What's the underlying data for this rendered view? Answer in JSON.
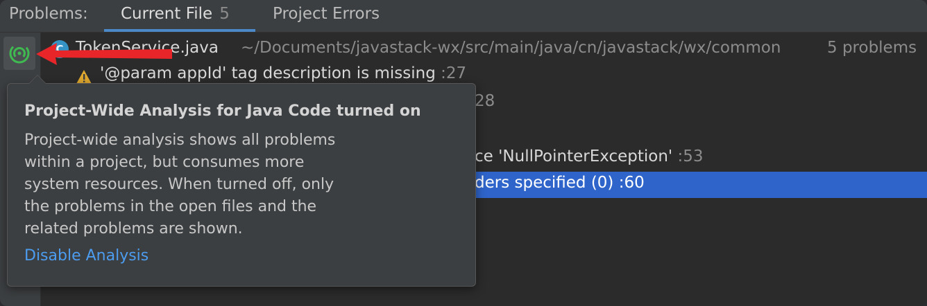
{
  "header": {
    "title": "Problems:",
    "tabs": [
      {
        "label": "Current File",
        "count": "5"
      },
      {
        "label": "Project Errors"
      }
    ]
  },
  "file": {
    "badge": "C",
    "name": "TokenService.java",
    "path": "~/Documents/javastack-wx/src/main/java/cn/javastack/wx/common",
    "count": "5 problems"
  },
  "problems": [
    {
      "message": "'@param appId' tag description is missing",
      "line": ":27",
      "icon": "warning-icon"
    },
    {
      "message": "",
      "line": "28"
    },
    {
      "message": "ce 'NullPointerException'",
      "line": ":53"
    },
    {
      "message": "ders specified (0) :60",
      "line": ""
    }
  ],
  "tooltip": {
    "title": "Project-Wide Analysis for Java Code turned on",
    "body_lines": [
      "Project-wide analysis shows all problems",
      "within a project, but consumes more",
      "system resources. When turned off, only",
      "the problems in the open files and the",
      "related problems are shown."
    ],
    "link": "Disable Analysis"
  },
  "colors": {
    "accent": "#4a88c7",
    "selection": "#2f65ca",
    "link": "#4c9cf0",
    "analysis_icon": "#3fb950",
    "arrow": "#e8262a"
  }
}
